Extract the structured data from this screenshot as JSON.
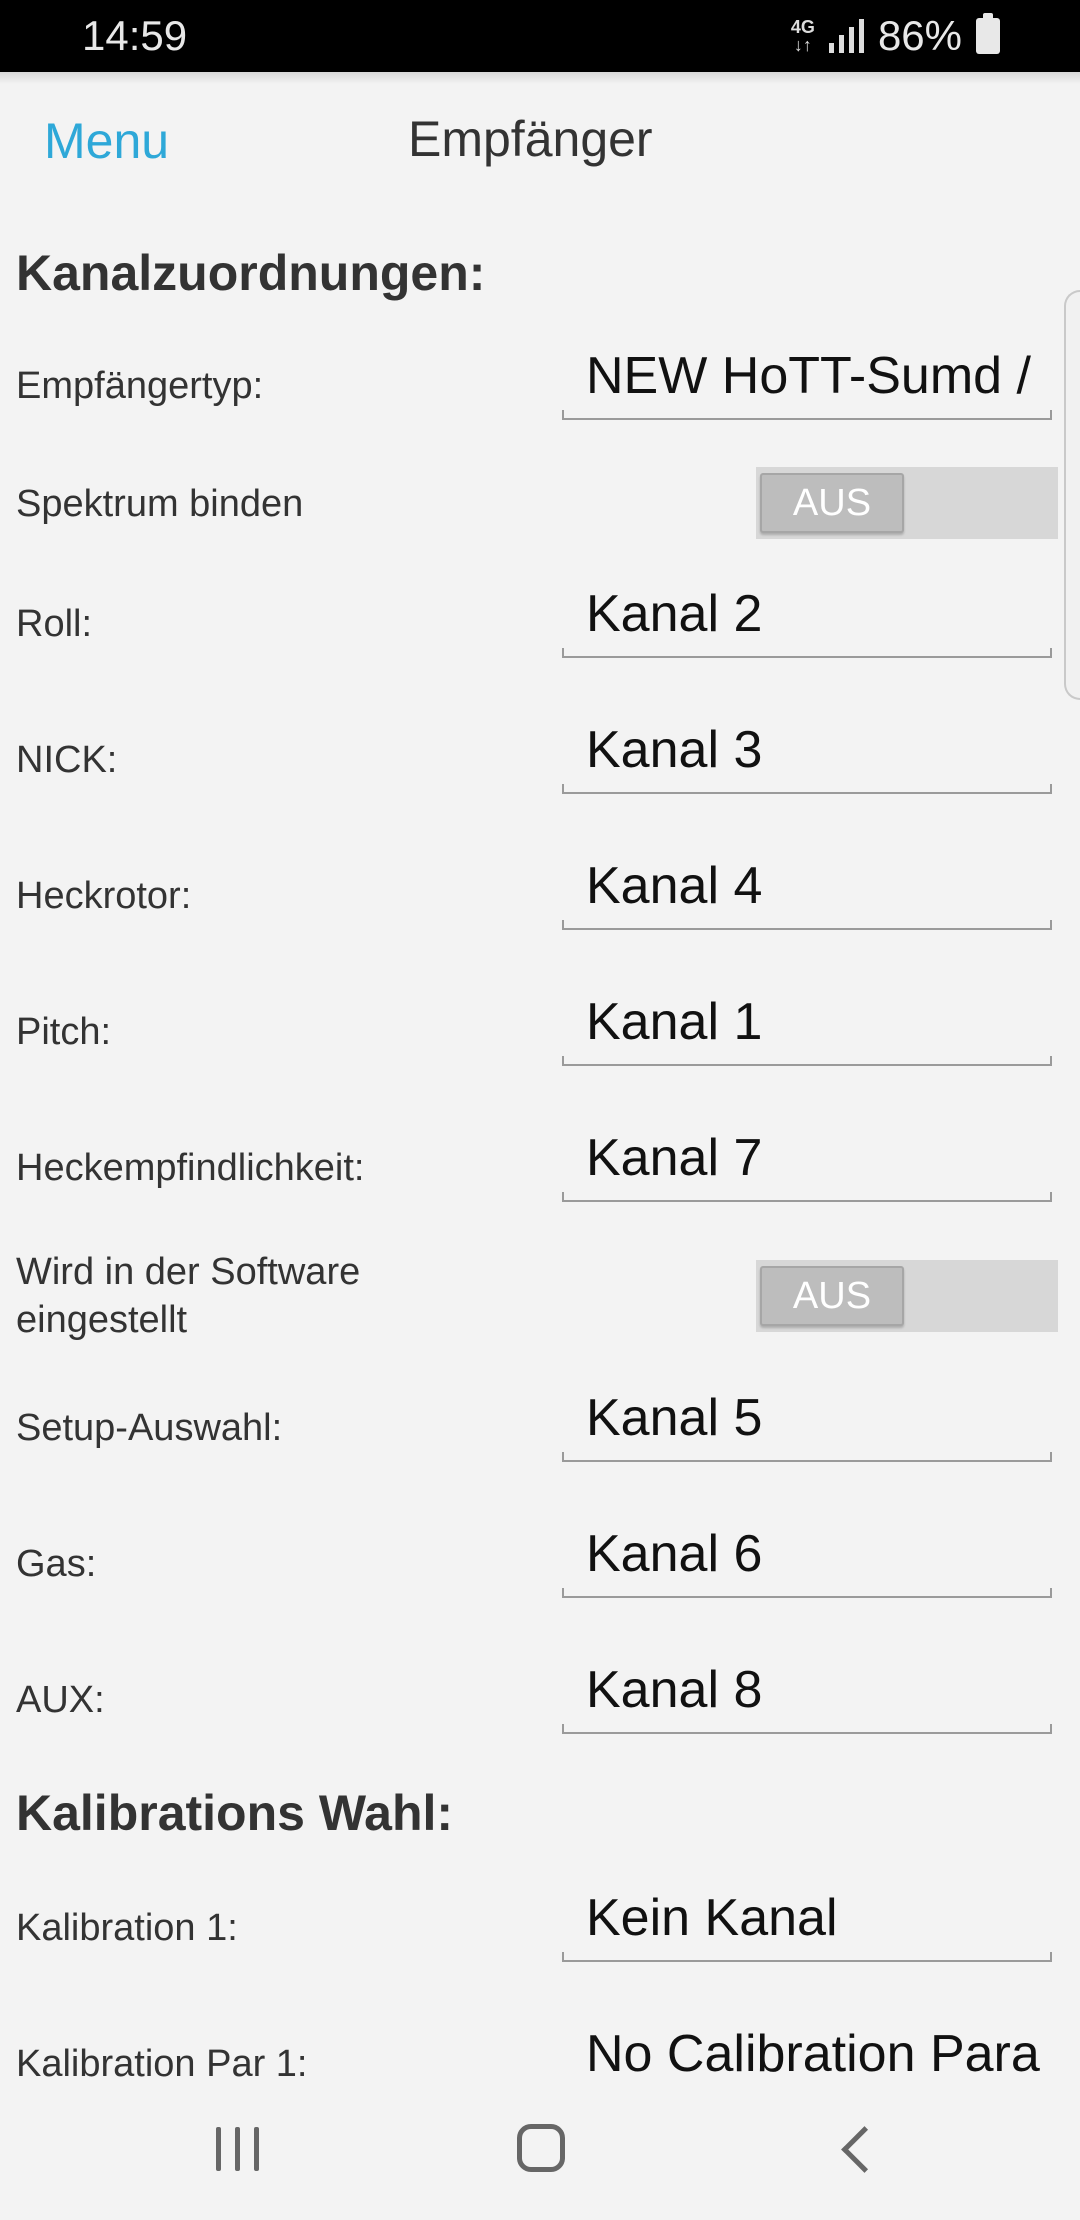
{
  "status_bar": {
    "time": "14:59",
    "network": "4G",
    "battery": "86%"
  },
  "header": {
    "menu_label": "Menu",
    "title": "Empfänger"
  },
  "sections": {
    "channels_title": "Kanalzuordnungen:",
    "calibration_title": "Kalibrations Wahl:"
  },
  "fields": {
    "receiver_type": {
      "label": "Empfängertyp:",
      "value": "NEW HoTT-Sumd /"
    },
    "spektrum_bind": {
      "label": "Spektrum binden",
      "value": "AUS"
    },
    "roll": {
      "label": "Roll:",
      "value": "Kanal 2"
    },
    "nick": {
      "label": "NICK:",
      "value": "Kanal 3"
    },
    "tail_rotor": {
      "label": "Heckrotor:",
      "value": "Kanal 4"
    },
    "pitch": {
      "label": "Pitch:",
      "value": "Kanal 1"
    },
    "tail_sensitivity": {
      "label": "Heckempfindlichkeit:",
      "value": "Kanal 7"
    },
    "software_setting": {
      "label_line1": "Wird in der Software",
      "label_line2": "eingestellt",
      "value": "AUS"
    },
    "setup_select": {
      "label": "Setup-Auswahl:",
      "value": "Kanal 5"
    },
    "gas": {
      "label": "Gas:",
      "value": "Kanal 6"
    },
    "aux": {
      "label": "AUX:",
      "value": "Kanal 8"
    },
    "calibration_1": {
      "label": "Kalibration 1:",
      "value": "Kein Kanal"
    },
    "calibration_par_1": {
      "label": "Kalibration Par 1:",
      "value": "No Calibration Para"
    }
  }
}
